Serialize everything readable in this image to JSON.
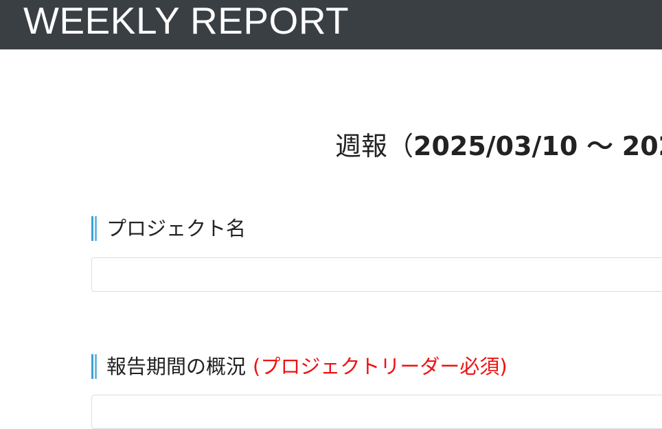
{
  "header": {
    "brand": "WEEKLY REPORT"
  },
  "report": {
    "title_prefix": "週報（",
    "title_range": "2025/03/10 ～ 202"
  },
  "sections": [
    {
      "label": "プロジェクト名",
      "note": "",
      "field_value": "",
      "placeholder": ""
    },
    {
      "label": "報告期間の概況",
      "note": "(プロジェクトリーダー必須)",
      "field_value": "",
      "placeholder": ""
    }
  ],
  "colors": {
    "header_bg": "#3a3f44",
    "accent_bar": "#3aa0d8",
    "required_note": "#ee1111"
  }
}
